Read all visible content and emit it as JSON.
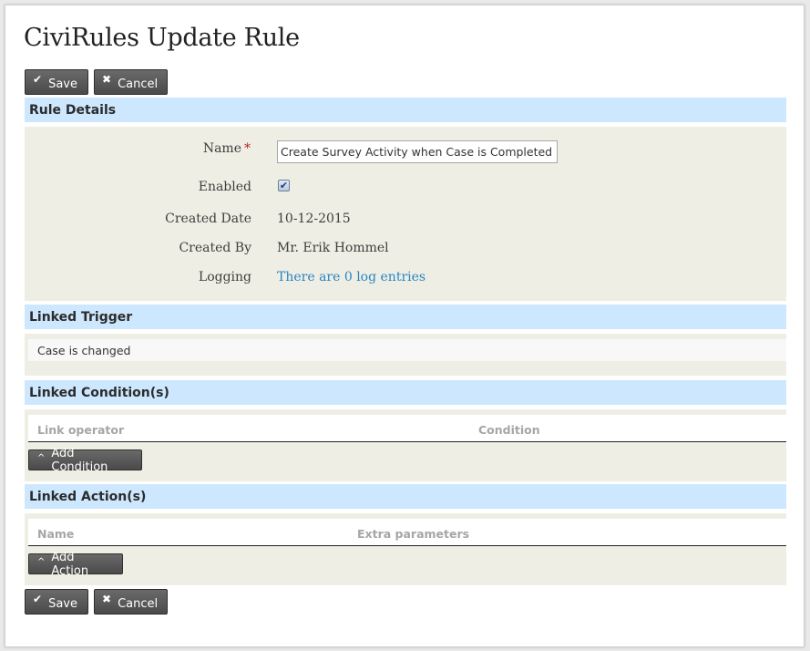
{
  "page": {
    "title": "CiviRules Update Rule"
  },
  "actions": {
    "save_label": "Save",
    "save_icon": "✔",
    "cancel_label": "Cancel",
    "cancel_icon": "✖"
  },
  "rule_details": {
    "header": "Rule Details",
    "name_label": "Name",
    "required_mark": "*",
    "name_value": "Create Survey Activity when Case is Completed",
    "enabled_label": "Enabled",
    "enabled_checked": true,
    "checkmark": "✔",
    "created_date_label": "Created Date",
    "created_date_value": "10-12-2015",
    "created_by_label": "Created By",
    "created_by_value": "Mr. Erik Hommel",
    "logging_label": "Logging",
    "logging_link": "There are 0 log entries"
  },
  "linked_trigger": {
    "header": "Linked Trigger",
    "value": "Case is changed"
  },
  "linked_conditions": {
    "header": "Linked Condition(s)",
    "columns": [
      "Link operator",
      "Condition"
    ],
    "add_label": "Add Condition",
    "add_icon": "^"
  },
  "linked_actions": {
    "header": "Linked Action(s)",
    "columns": [
      "Name",
      "Extra parameters"
    ],
    "add_label": "Add Action",
    "add_icon": "^"
  },
  "colors": {
    "section_header_bg": "#cde8fe",
    "panel_bg": "#efeee4",
    "link": "#2786c2",
    "button": "#555555",
    "required": "#bb2222"
  }
}
